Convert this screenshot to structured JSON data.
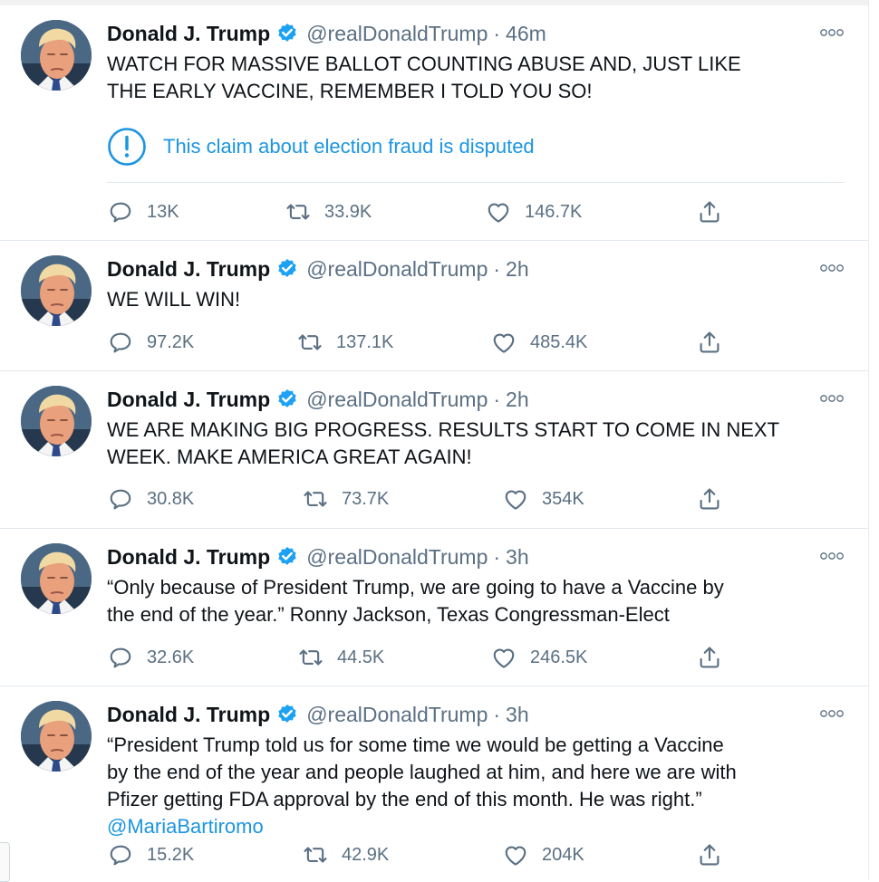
{
  "colors": {
    "accent": "#1b95e0",
    "muted": "#5b7083",
    "divider": "#e1e8ed"
  },
  "icons": {
    "reply": "reply-icon",
    "retweet": "retweet-icon",
    "like": "like-icon",
    "share": "share-icon",
    "more": "more-icon",
    "verified": "verified-badge-icon",
    "disputed": "exclamation-circle-icon"
  },
  "tweets": [
    {
      "name": "Donald J. Trump",
      "handle": "@realDonaldTrump",
      "separator": "·",
      "time": "46m",
      "lines": [
        "WATCH FOR MASSIVE BALLOT COUNTING ABUSE AND, JUST LIKE",
        "THE EARLY VACCINE, REMEMBER I TOLD YOU SO!"
      ],
      "label": "This claim about election fraud is disputed",
      "stats": {
        "replies": "13K",
        "retweets": "33.9K",
        "likes": "146.7K"
      }
    },
    {
      "name": "Donald J. Trump",
      "handle": "@realDonaldTrump",
      "separator": "·",
      "time": "2h",
      "lines": [
        "WE WILL WIN!"
      ],
      "stats": {
        "replies": "97.2K",
        "retweets": "137.1K",
        "likes": "485.4K"
      }
    },
    {
      "name": "Donald J. Trump",
      "handle": "@realDonaldTrump",
      "separator": "·",
      "time": "2h",
      "lines": [
        "WE ARE MAKING BIG PROGRESS. RESULTS START TO COME IN NEXT",
        "WEEK. MAKE AMERICA GREAT AGAIN!"
      ],
      "stats": {
        "replies": "30.8K",
        "retweets": "73.7K",
        "likes": "354K"
      }
    },
    {
      "name": "Donald J. Trump",
      "handle": "@realDonaldTrump",
      "separator": "·",
      "time": "3h",
      "lines": [
        "“Only because of President Trump, we are going to have a Vaccine by",
        "the end of the year.”  Ronny Jackson, Texas Congressman-Elect"
      ],
      "stats": {
        "replies": "32.6K",
        "retweets": "44.5K",
        "likes": "246.5K"
      }
    },
    {
      "name": "Donald J. Trump",
      "handle": "@realDonaldTrump",
      "separator": "·",
      "time": "3h",
      "lines": [
        "“President Trump told us for some time we would be getting a Vaccine",
        "by the end of the year and people laughed at him, and here we are with",
        "Pfizer getting FDA approval by the end of this month. He was right.”"
      ],
      "mention": "@MariaBartiromo",
      "stats": {
        "replies": "15.2K",
        "retweets": "42.9K",
        "likes": "204K"
      }
    }
  ]
}
